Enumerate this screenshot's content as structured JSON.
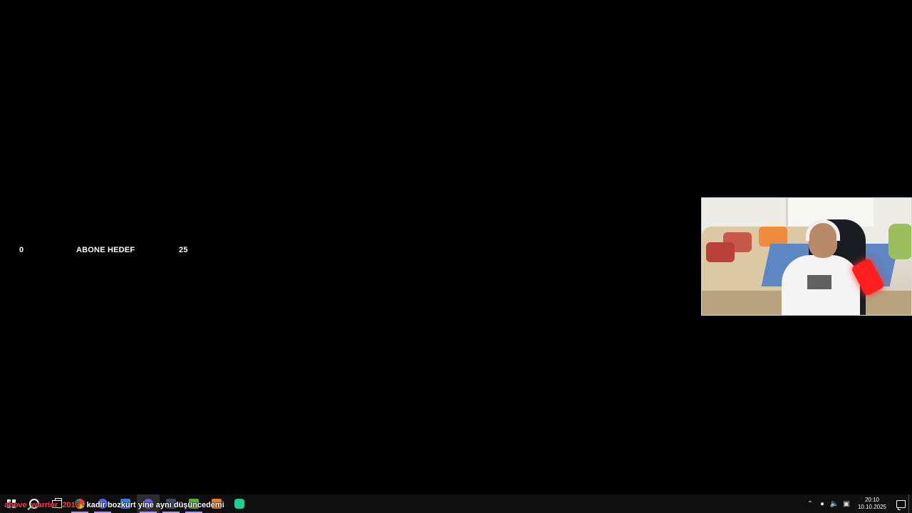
{
  "goal": {
    "current": "0",
    "label": "ABONE HEDEF",
    "target": "25"
  },
  "chat": {
    "username": "above_warrior_2013",
    "separator": ":",
    "message": "kadir bozkurt yine aynı düşüncedemi"
  },
  "taskbar": {
    "apps": [
      {
        "name": "start-button-icon"
      },
      {
        "name": "search-icon"
      },
      {
        "name": "task-view-icon"
      },
      {
        "name": "chrome-icon",
        "color": "#e34133"
      },
      {
        "name": "discord-icon",
        "color": "#5865f2"
      },
      {
        "name": "app-icon-blue",
        "color": "#3f7fd8"
      },
      {
        "name": "obs-icon",
        "color": "#6b5bd6"
      },
      {
        "name": "app-icon-dark",
        "color": "#3c4a66"
      },
      {
        "name": "app-icon-green",
        "color": "#5fae3a"
      },
      {
        "name": "app-icon-orange",
        "color": "#f07c1e"
      },
      {
        "name": "app-icon-teal",
        "color": "#1fcf8c"
      }
    ],
    "tray": {
      "clock_time": "20:10",
      "clock_date": "10.10.2025"
    }
  },
  "colors": {
    "chat_username": "#ff3b50",
    "accent_underline": "#b693e6"
  }
}
